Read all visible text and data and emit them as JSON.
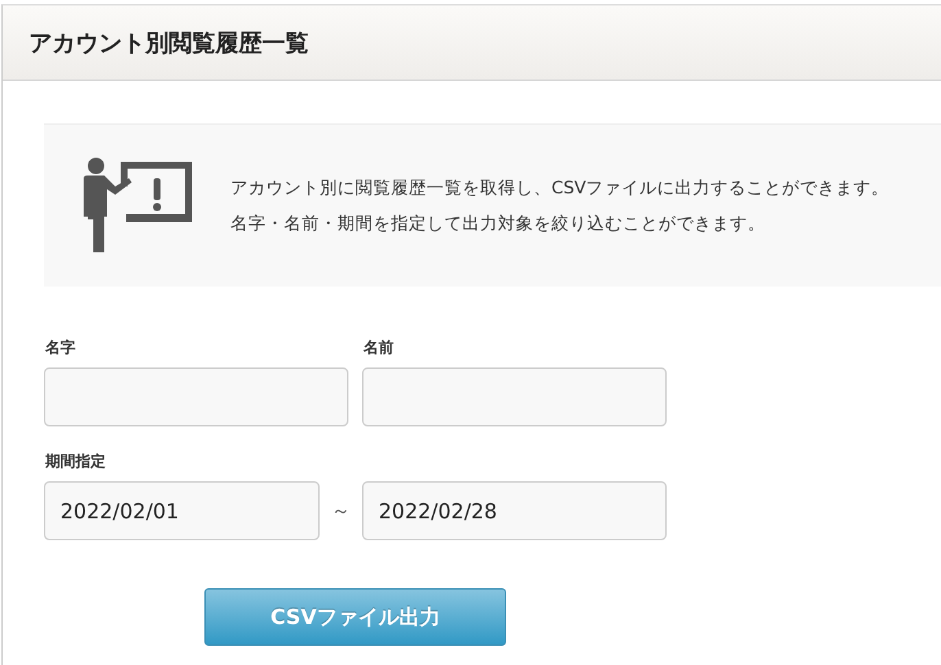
{
  "title": "アカウント別閲覧履歴一覧",
  "info": {
    "lines": [
      "アカウント別に閲覧履歴一覧を取得し、CSVファイルに出力することができます。",
      "名字・名前・期間を指定して出力対象を絞り込むことができます。"
    ]
  },
  "name_fields": [
    {
      "label": "名字"
    },
    {
      "label": "名前"
    }
  ],
  "period": {
    "label": "期間指定",
    "from": "2022/02/01",
    "separator": "～",
    "to": "2022/02/28"
  },
  "export_button": "CSVファイル出力"
}
